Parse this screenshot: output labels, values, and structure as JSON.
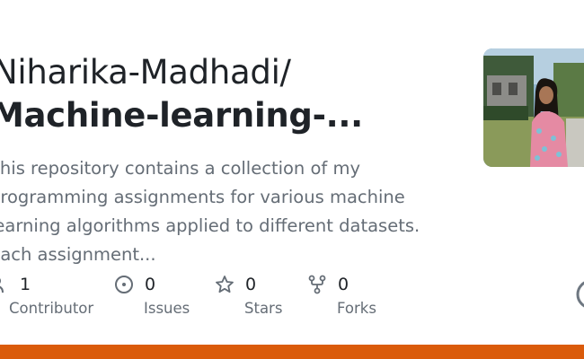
{
  "repository": {
    "owner": "Niharika-Madhadi/",
    "name": "Machine-learning-...",
    "description_lines": [
      "This repository contains a collection of my",
      "programming assignments for various machine",
      "learning algorithms applied to different datasets.",
      "Each assignment..."
    ]
  },
  "stats": {
    "contributors": {
      "count": "1",
      "label": "Contributor",
      "icon": "people-icon"
    },
    "issues": {
      "count": "0",
      "label": "Issues",
      "icon": "issue-opened-icon"
    },
    "stars": {
      "count": "0",
      "label": "Stars",
      "icon": "star-icon"
    },
    "forks": {
      "count": "0",
      "label": "Forks",
      "icon": "repo-forked-icon"
    }
  },
  "colors": {
    "language_bar": "#da5b0b",
    "title_text": "#1f2328",
    "muted_text": "#656d76"
  }
}
